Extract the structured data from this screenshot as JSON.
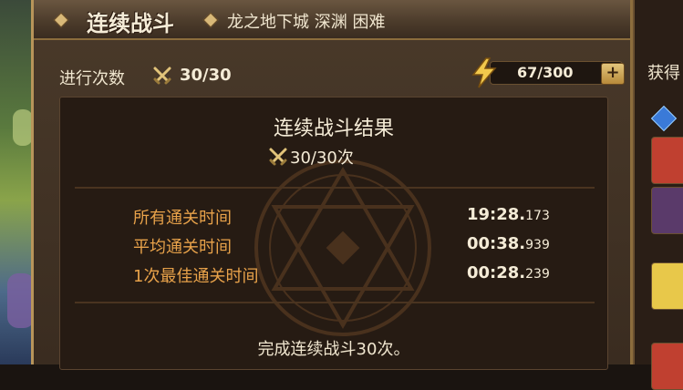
{
  "header": {
    "title": "连续战斗",
    "subtitle": "龙之地下城 深渊 困难"
  },
  "progress": {
    "label": "进行次数",
    "value": "30/30"
  },
  "energy": {
    "value": "67/300",
    "plus": "+",
    "level": 0.223
  },
  "rewards": {
    "label": "获得"
  },
  "results": {
    "title": "连续战斗结果",
    "count": "30/30次",
    "stats": [
      {
        "label": "所有通关时间",
        "value": "19:28.",
        "ms": "173"
      },
      {
        "label": "平均通关时间",
        "value": "00:38.",
        "ms": "939"
      },
      {
        "label": "1次最佳通关时间",
        "value": "00:28.",
        "ms": "239"
      }
    ],
    "completion": "完成连续战斗30次。"
  },
  "colors": {
    "accent_orange": "#e8a24a",
    "frame_gold": "#b8955a",
    "panel_bg": "#261b13"
  }
}
